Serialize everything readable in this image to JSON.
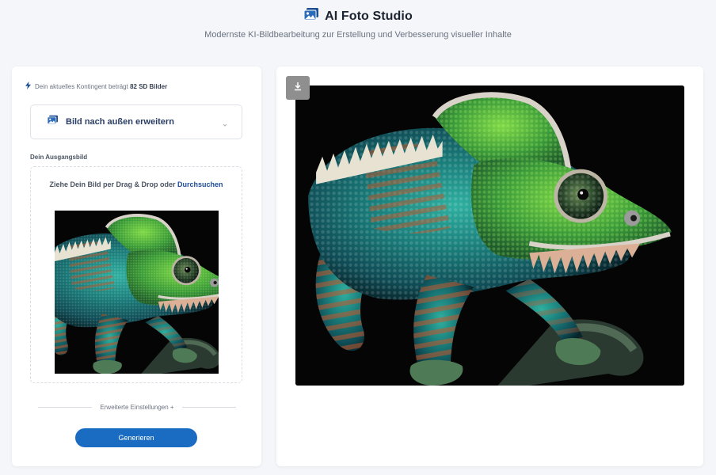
{
  "header": {
    "title": "AI Foto Studio",
    "subtitle": "Modernste KI-Bildbearbeitung zur Erstellung und Verbesserung visueller Inhalte",
    "logo_icon": "images-icon"
  },
  "left_panel": {
    "quota_prefix": "Dein aktuelles Kontingent beträgt ",
    "quota_value": "82 SD Bilder",
    "quota_icon": "lightning-icon",
    "mode_select": {
      "selected": "Bild nach außen erweitern",
      "icon": "images-icon",
      "chevron": "chevron-down-icon"
    },
    "source_label": "Dein Ausgangsbild",
    "dropzone": {
      "text": "Ziehe Dein Bild per Drag & Drop oder ",
      "link": "Durchsuchen"
    },
    "advanced_settings": "Erweiterte Einstellungen +",
    "generate_label": "Generieren"
  },
  "right_panel": {
    "download_icon": "download-icon"
  },
  "colors": {
    "accent": "#1a6cc2",
    "title_dark": "#1b2230",
    "link": "#1e4c96",
    "background": "#f4f6f9"
  }
}
